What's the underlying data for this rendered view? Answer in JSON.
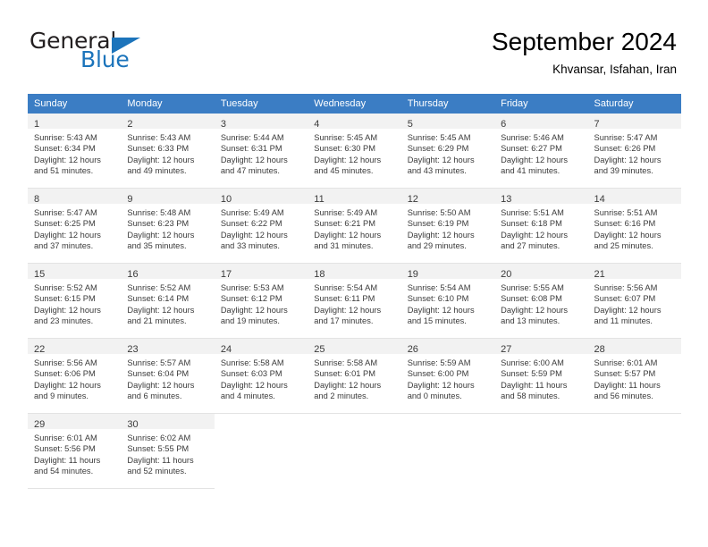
{
  "brand": {
    "name_part1": "General",
    "name_part2": "Blue",
    "accent_color": "#1c74bb"
  },
  "header": {
    "title": "September 2024",
    "subtitle": "Khvansar, Isfahan, Iran"
  },
  "calendar": {
    "header_bg": "#3b7dc4",
    "weekdays": [
      "Sunday",
      "Monday",
      "Tuesday",
      "Wednesday",
      "Thursday",
      "Friday",
      "Saturday"
    ],
    "weeks": [
      [
        {
          "day": "1",
          "sunrise": "Sunrise: 5:43 AM",
          "sunset": "Sunset: 6:34 PM",
          "daylight_line1": "Daylight: 12 hours",
          "daylight_line2": "and 51 minutes."
        },
        {
          "day": "2",
          "sunrise": "Sunrise: 5:43 AM",
          "sunset": "Sunset: 6:33 PM",
          "daylight_line1": "Daylight: 12 hours",
          "daylight_line2": "and 49 minutes."
        },
        {
          "day": "3",
          "sunrise": "Sunrise: 5:44 AM",
          "sunset": "Sunset: 6:31 PM",
          "daylight_line1": "Daylight: 12 hours",
          "daylight_line2": "and 47 minutes."
        },
        {
          "day": "4",
          "sunrise": "Sunrise: 5:45 AM",
          "sunset": "Sunset: 6:30 PM",
          "daylight_line1": "Daylight: 12 hours",
          "daylight_line2": "and 45 minutes."
        },
        {
          "day": "5",
          "sunrise": "Sunrise: 5:45 AM",
          "sunset": "Sunset: 6:29 PM",
          "daylight_line1": "Daylight: 12 hours",
          "daylight_line2": "and 43 minutes."
        },
        {
          "day": "6",
          "sunrise": "Sunrise: 5:46 AM",
          "sunset": "Sunset: 6:27 PM",
          "daylight_line1": "Daylight: 12 hours",
          "daylight_line2": "and 41 minutes."
        },
        {
          "day": "7",
          "sunrise": "Sunrise: 5:47 AM",
          "sunset": "Sunset: 6:26 PM",
          "daylight_line1": "Daylight: 12 hours",
          "daylight_line2": "and 39 minutes."
        }
      ],
      [
        {
          "day": "8",
          "sunrise": "Sunrise: 5:47 AM",
          "sunset": "Sunset: 6:25 PM",
          "daylight_line1": "Daylight: 12 hours",
          "daylight_line2": "and 37 minutes."
        },
        {
          "day": "9",
          "sunrise": "Sunrise: 5:48 AM",
          "sunset": "Sunset: 6:23 PM",
          "daylight_line1": "Daylight: 12 hours",
          "daylight_line2": "and 35 minutes."
        },
        {
          "day": "10",
          "sunrise": "Sunrise: 5:49 AM",
          "sunset": "Sunset: 6:22 PM",
          "daylight_line1": "Daylight: 12 hours",
          "daylight_line2": "and 33 minutes."
        },
        {
          "day": "11",
          "sunrise": "Sunrise: 5:49 AM",
          "sunset": "Sunset: 6:21 PM",
          "daylight_line1": "Daylight: 12 hours",
          "daylight_line2": "and 31 minutes."
        },
        {
          "day": "12",
          "sunrise": "Sunrise: 5:50 AM",
          "sunset": "Sunset: 6:19 PM",
          "daylight_line1": "Daylight: 12 hours",
          "daylight_line2": "and 29 minutes."
        },
        {
          "day": "13",
          "sunrise": "Sunrise: 5:51 AM",
          "sunset": "Sunset: 6:18 PM",
          "daylight_line1": "Daylight: 12 hours",
          "daylight_line2": "and 27 minutes."
        },
        {
          "day": "14",
          "sunrise": "Sunrise: 5:51 AM",
          "sunset": "Sunset: 6:16 PM",
          "daylight_line1": "Daylight: 12 hours",
          "daylight_line2": "and 25 minutes."
        }
      ],
      [
        {
          "day": "15",
          "sunrise": "Sunrise: 5:52 AM",
          "sunset": "Sunset: 6:15 PM",
          "daylight_line1": "Daylight: 12 hours",
          "daylight_line2": "and 23 minutes."
        },
        {
          "day": "16",
          "sunrise": "Sunrise: 5:52 AM",
          "sunset": "Sunset: 6:14 PM",
          "daylight_line1": "Daylight: 12 hours",
          "daylight_line2": "and 21 minutes."
        },
        {
          "day": "17",
          "sunrise": "Sunrise: 5:53 AM",
          "sunset": "Sunset: 6:12 PM",
          "daylight_line1": "Daylight: 12 hours",
          "daylight_line2": "and 19 minutes."
        },
        {
          "day": "18",
          "sunrise": "Sunrise: 5:54 AM",
          "sunset": "Sunset: 6:11 PM",
          "daylight_line1": "Daylight: 12 hours",
          "daylight_line2": "and 17 minutes."
        },
        {
          "day": "19",
          "sunrise": "Sunrise: 5:54 AM",
          "sunset": "Sunset: 6:10 PM",
          "daylight_line1": "Daylight: 12 hours",
          "daylight_line2": "and 15 minutes."
        },
        {
          "day": "20",
          "sunrise": "Sunrise: 5:55 AM",
          "sunset": "Sunset: 6:08 PM",
          "daylight_line1": "Daylight: 12 hours",
          "daylight_line2": "and 13 minutes."
        },
        {
          "day": "21",
          "sunrise": "Sunrise: 5:56 AM",
          "sunset": "Sunset: 6:07 PM",
          "daylight_line1": "Daylight: 12 hours",
          "daylight_line2": "and 11 minutes."
        }
      ],
      [
        {
          "day": "22",
          "sunrise": "Sunrise: 5:56 AM",
          "sunset": "Sunset: 6:06 PM",
          "daylight_line1": "Daylight: 12 hours",
          "daylight_line2": "and 9 minutes."
        },
        {
          "day": "23",
          "sunrise": "Sunrise: 5:57 AM",
          "sunset": "Sunset: 6:04 PM",
          "daylight_line1": "Daylight: 12 hours",
          "daylight_line2": "and 6 minutes."
        },
        {
          "day": "24",
          "sunrise": "Sunrise: 5:58 AM",
          "sunset": "Sunset: 6:03 PM",
          "daylight_line1": "Daylight: 12 hours",
          "daylight_line2": "and 4 minutes."
        },
        {
          "day": "25",
          "sunrise": "Sunrise: 5:58 AM",
          "sunset": "Sunset: 6:01 PM",
          "daylight_line1": "Daylight: 12 hours",
          "daylight_line2": "and 2 minutes."
        },
        {
          "day": "26",
          "sunrise": "Sunrise: 5:59 AM",
          "sunset": "Sunset: 6:00 PM",
          "daylight_line1": "Daylight: 12 hours",
          "daylight_line2": "and 0 minutes."
        },
        {
          "day": "27",
          "sunrise": "Sunrise: 6:00 AM",
          "sunset": "Sunset: 5:59 PM",
          "daylight_line1": "Daylight: 11 hours",
          "daylight_line2": "and 58 minutes."
        },
        {
          "day": "28",
          "sunrise": "Sunrise: 6:01 AM",
          "sunset": "Sunset: 5:57 PM",
          "daylight_line1": "Daylight: 11 hours",
          "daylight_line2": "and 56 minutes."
        }
      ],
      [
        {
          "day": "29",
          "sunrise": "Sunrise: 6:01 AM",
          "sunset": "Sunset: 5:56 PM",
          "daylight_line1": "Daylight: 11 hours",
          "daylight_line2": "and 54 minutes."
        },
        {
          "day": "30",
          "sunrise": "Sunrise: 6:02 AM",
          "sunset": "Sunset: 5:55 PM",
          "daylight_line1": "Daylight: 11 hours",
          "daylight_line2": "and 52 minutes."
        },
        null,
        null,
        null,
        null,
        null
      ]
    ]
  }
}
